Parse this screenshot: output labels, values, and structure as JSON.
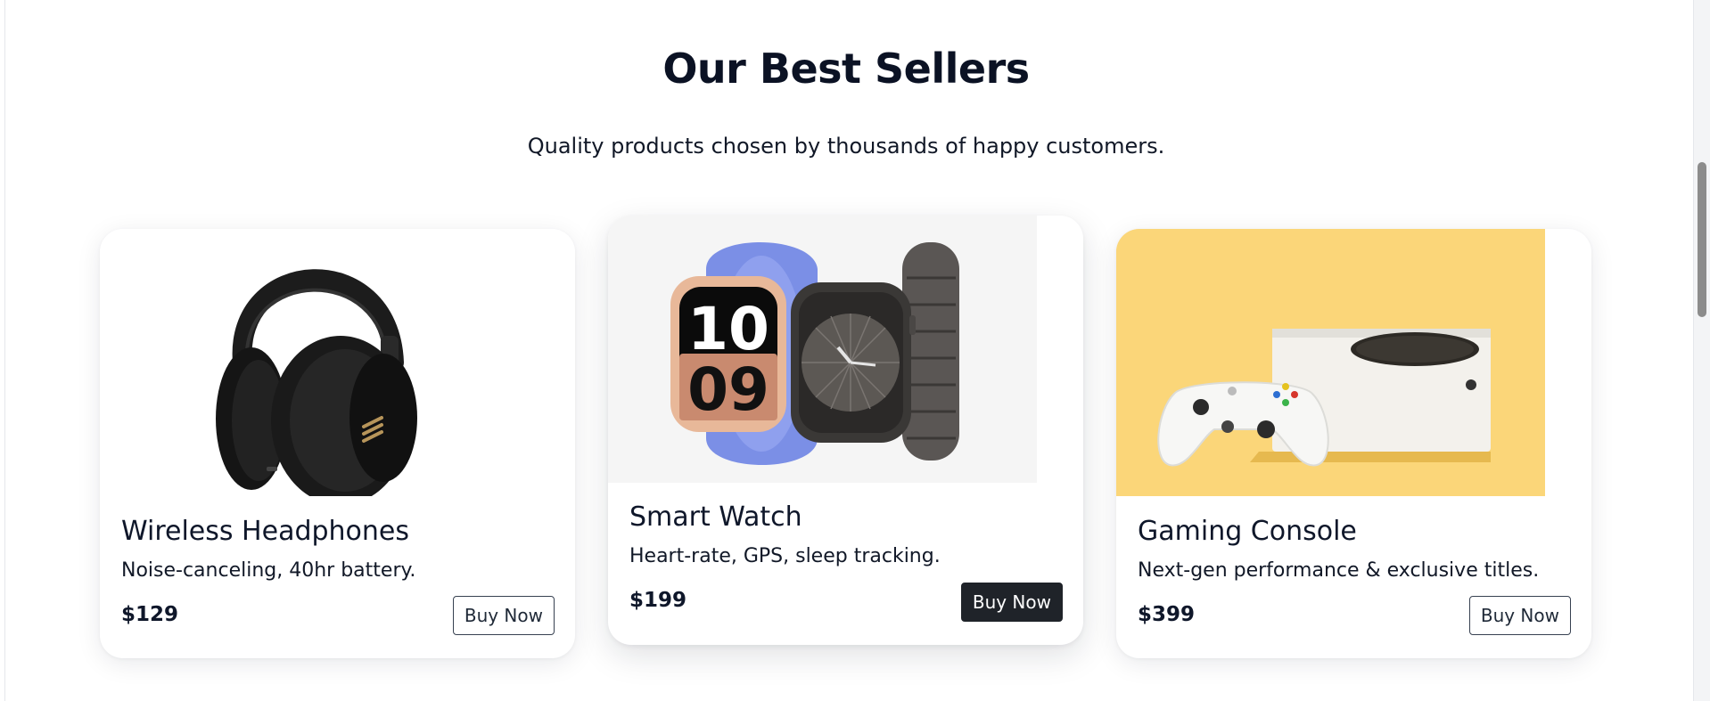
{
  "section": {
    "title": "Our Best Sellers",
    "subtitle": "Quality products chosen by thousands of happy customers."
  },
  "products": [
    {
      "title": "Wireless Headphones",
      "description": "Noise-canceling, 40hr battery.",
      "price": "$129",
      "button": "Buy Now",
      "image": "headphones-photo"
    },
    {
      "title": "Smart Watch",
      "description": "Heart-rate, GPS, sleep tracking.",
      "price": "$199",
      "button": "Buy Now",
      "image": "smartwatch-photo",
      "watch_face_digits": [
        "10",
        "09"
      ]
    },
    {
      "title": "Gaming Console",
      "description": "Next-gen performance & exclusive titles.",
      "price": "$399",
      "button": "Buy Now",
      "image": "console-photo"
    }
  ],
  "colors": {
    "text_dark": "#0f172a",
    "button_active_bg": "#1f2329",
    "console_background": "#fbd679",
    "watch_background": "#f5f5f5"
  }
}
